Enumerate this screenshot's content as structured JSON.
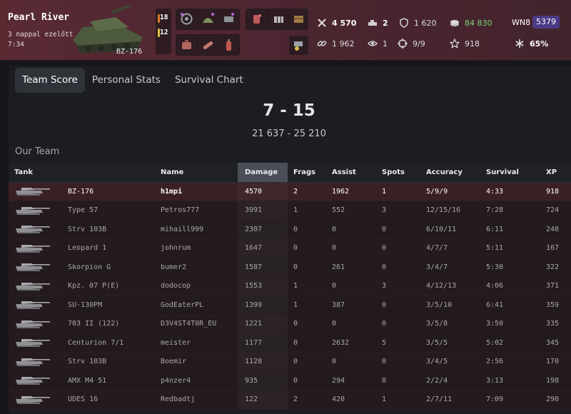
{
  "header": {
    "map_name": "Pearl River",
    "time_ago": "3 nappal ezelőtt",
    "duration": "7:34",
    "tank_name": "BZ-176",
    "shells": [
      "18",
      "12"
    ],
    "stats": {
      "frags_icon": "crossed-swords-icon",
      "damage": "4 570",
      "kills_icon": "destroyed-tank-icon",
      "kills": "2",
      "blocked_icon": "shield-icon",
      "blocked": "1 620",
      "credits_icon": "credits-icon",
      "credits": "84 830",
      "wn8_label": "WN8",
      "wn8_value": "5379",
      "assist_icon": "link-icon",
      "assist": "1 962",
      "spots_icon": "eye-icon",
      "spots": "1",
      "hits_icon": "crosshair-icon",
      "hits": "9/9",
      "xp_icon": "star-icon",
      "xp": "918",
      "percent_icon": "asterisk-icon",
      "percent": "65%"
    },
    "colors": {
      "wn8_badge": "#4b3b86",
      "credits": "#7fd27a",
      "header_bg": "#5a2a33"
    }
  },
  "tabs": [
    {
      "label": "Team Score",
      "active": true
    },
    {
      "label": "Personal Stats",
      "active": false
    },
    {
      "label": "Survival Chart",
      "active": false
    }
  ],
  "score": {
    "result": "7 - 15",
    "damage": "21 637 - 25 210"
  },
  "team": {
    "title": "Our Team",
    "columns": [
      "Tank",
      "Name",
      "Damage",
      "Frags",
      "Assist",
      "Spots",
      "Accuracy",
      "Survival",
      "XP"
    ],
    "sorted_column": "Damage",
    "rows": [
      {
        "tank": "BZ-176",
        "name": "h1mpi",
        "damage": "4570",
        "frags": "2",
        "assist": "1962",
        "spots": "1",
        "accuracy": "5/9/9",
        "survival": "4:33",
        "xp": "918"
      },
      {
        "tank": "Type 57",
        "name": "Petros777",
        "damage": "3991",
        "frags": "1",
        "assist": "552",
        "spots": "3",
        "accuracy": "12/15/16",
        "survival": "7:28",
        "xp": "724"
      },
      {
        "tank": "Strv 103B",
        "name": "mihaill999",
        "damage": "2307",
        "frags": "0",
        "assist": "0",
        "spots": "0",
        "accuracy": "6/10/11",
        "survival": "6:11",
        "xp": "248"
      },
      {
        "tank": "Leopard 1",
        "name": "johnrum",
        "damage": "1647",
        "frags": "0",
        "assist": "0",
        "spots": "0",
        "accuracy": "4/7/7",
        "survival": "5:11",
        "xp": "167"
      },
      {
        "tank": "Skorpion G",
        "name": "bumer2",
        "damage": "1587",
        "frags": "0",
        "assist": "261",
        "spots": "0",
        "accuracy": "3/4/7",
        "survival": "5:30",
        "xp": "322"
      },
      {
        "tank": "Kpz. 07 P(E)",
        "name": "dodocop",
        "damage": "1553",
        "frags": "1",
        "assist": "0",
        "spots": "3",
        "accuracy": "4/12/13",
        "survival": "4:06",
        "xp": "371"
      },
      {
        "tank": "SU-130PM",
        "name": "GodEaterPL",
        "damage": "1399",
        "frags": "1",
        "assist": "387",
        "spots": "0",
        "accuracy": "3/5/10",
        "survival": "6:41",
        "xp": "359"
      },
      {
        "tank": "703 II (122)",
        "name": "D3V4ST4T0R_EU",
        "damage": "1221",
        "frags": "0",
        "assist": "0",
        "spots": "0",
        "accuracy": "3/5/8",
        "survival": "3:50",
        "xp": "335"
      },
      {
        "tank": "Centurion 7/1",
        "name": "meister",
        "damage": "1177",
        "frags": "0",
        "assist": "2632",
        "spots": "5",
        "accuracy": "3/5/5",
        "survival": "5:02",
        "xp": "345"
      },
      {
        "tank": "Strv 103B",
        "name": "Boemir",
        "damage": "1128",
        "frags": "0",
        "assist": "0",
        "spots": "0",
        "accuracy": "3/4/5",
        "survival": "2:56",
        "xp": "170"
      },
      {
        "tank": "AMX M4 51",
        "name": "p4nzer4",
        "damage": "935",
        "frags": "0",
        "assist": "294",
        "spots": "0",
        "accuracy": "2/2/4",
        "survival": "3:13",
        "xp": "198"
      },
      {
        "tank": "UDES 16",
        "name": "Redbadtj",
        "damage": "122",
        "frags": "2",
        "assist": "420",
        "spots": "1",
        "accuracy": "2/7/11",
        "survival": "7:09",
        "xp": "290"
      }
    ]
  }
}
